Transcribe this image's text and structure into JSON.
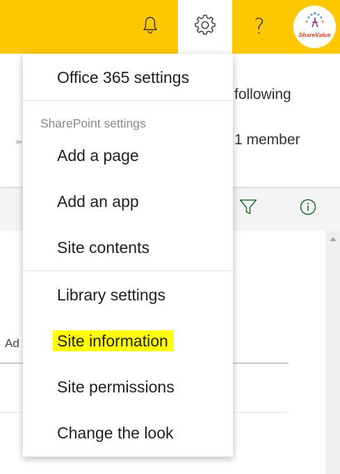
{
  "suite_bar": {
    "bell_icon": "bell-icon",
    "gear_icon": "gear-icon",
    "help_icon": "question-mark-icon",
    "help_glyph": "?",
    "avatar_label": "ShareValue",
    "accent_color": "#fdc800"
  },
  "header": {
    "following": "following",
    "members": "1 member",
    "tiny": "SH"
  },
  "command_bar": {
    "filter_icon": "filter-icon",
    "info_icon": "info-icon"
  },
  "list": {
    "column_header": "Ad"
  },
  "settings_menu": {
    "office365": "Office 365 settings",
    "section_label": "SharePoint settings",
    "add_page": "Add a page",
    "add_app": "Add an app",
    "site_contents": "Site contents",
    "library_settings": "Library settings",
    "site_information": "Site information",
    "site_permissions": "Site permissions",
    "change_look": "Change the look",
    "highlight_color": "#ffff00"
  }
}
